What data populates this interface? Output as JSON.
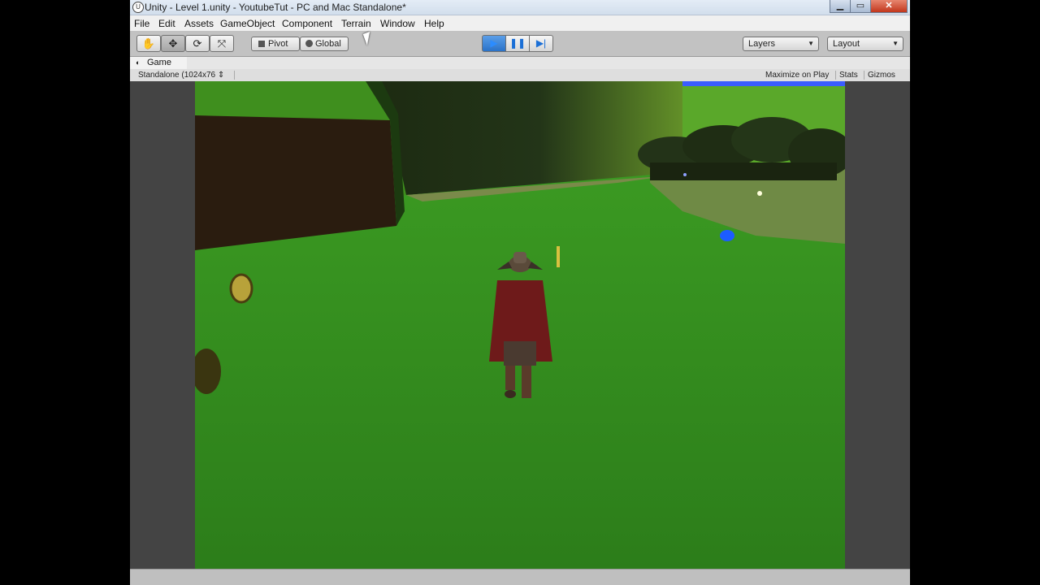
{
  "window": {
    "title": "Unity - Level 1.unity - YoutubeTut - PC and Mac Standalone*",
    "controls": {
      "minimize": "▁",
      "maximize": "▭",
      "close": "✕"
    }
  },
  "menu": [
    "File",
    "Edit",
    "Assets",
    "GameObject",
    "Component",
    "Terrain",
    "Window",
    "Help"
  ],
  "toolbar": {
    "tools": [
      {
        "name": "hand-tool",
        "glyph": "✋",
        "active": false
      },
      {
        "name": "move-tool",
        "glyph": "✥",
        "active": true
      },
      {
        "name": "rotate-tool",
        "glyph": "⟳",
        "active": false
      },
      {
        "name": "scale-tool",
        "glyph": "⤧",
        "active": false
      }
    ],
    "pivot_label": "Pivot",
    "global_label": "Global",
    "playback": {
      "play": "▶",
      "pause": "❚❚",
      "step": "▶|"
    },
    "layers_label": "Layers",
    "layout_label": "Layout"
  },
  "game_view": {
    "tab_label": "Game",
    "resolution": "Standalone (1024x76",
    "maximize_on_play": "Maximize on Play",
    "stats": "Stats",
    "gizmos": "Gizmos"
  },
  "scene": {
    "colors": {
      "grass": "#2b7f1a",
      "wall": "#2a1c0f",
      "path": "#7a8a4a",
      "cape": "#6e1a1a",
      "marker": "#1c5cff"
    }
  }
}
